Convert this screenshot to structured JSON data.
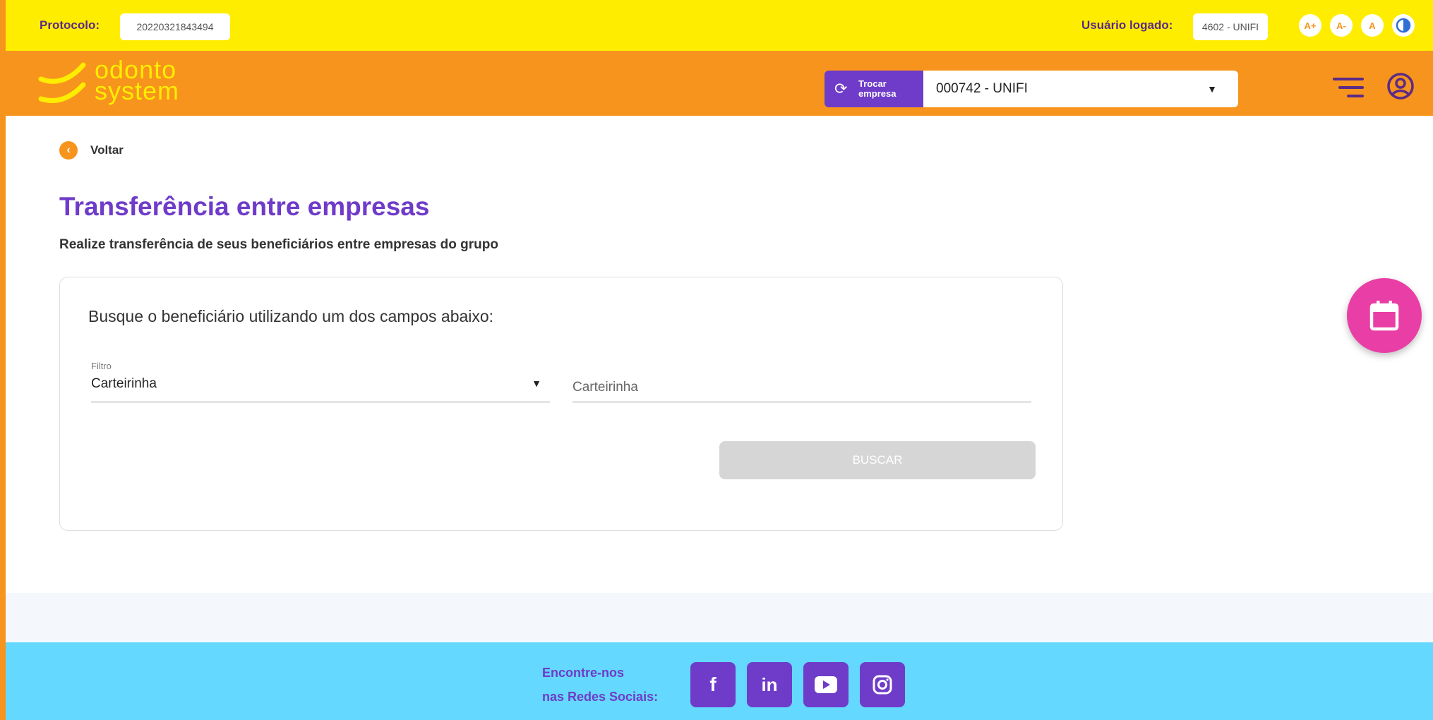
{
  "topbar": {
    "protocol_label": "Protocolo:",
    "protocol_value": "20220321843494",
    "user_label": "Usuário logado:",
    "user_value": "4602 - UNIFI",
    "font_increase": "A+",
    "font_decrease": "A-",
    "font_reset": "A"
  },
  "header": {
    "logo_line1": "odonto",
    "logo_line2": "system",
    "switch_company_line1": "Trocar",
    "switch_company_line2": "empresa",
    "selected_company": "000742 - UNIFI"
  },
  "main": {
    "back_label": "Voltar",
    "title": "Transferência entre empresas",
    "subtitle": "Realize transferência de seus beneficiários entre empresas do grupo",
    "card_heading": "Busque o beneficiário utilizando um dos campos abaixo:",
    "filter_label": "Filtro",
    "filter_value": "Carteirinha",
    "search_placeholder": "Carteirinha",
    "search_button": "BUSCAR"
  },
  "footer": {
    "social_line1": "Encontre-nos",
    "social_line2": "nas Redes Sociais:",
    "social_icons": [
      "facebook-icon",
      "linkedin-icon",
      "youtube-icon",
      "instagram-icon"
    ]
  },
  "colors": {
    "topbar": "#ffed00",
    "header": "#f7941d",
    "primary_purple": "#6f3bc9",
    "fab_pink": "#e93ea5",
    "footer": "#64d8ff"
  }
}
